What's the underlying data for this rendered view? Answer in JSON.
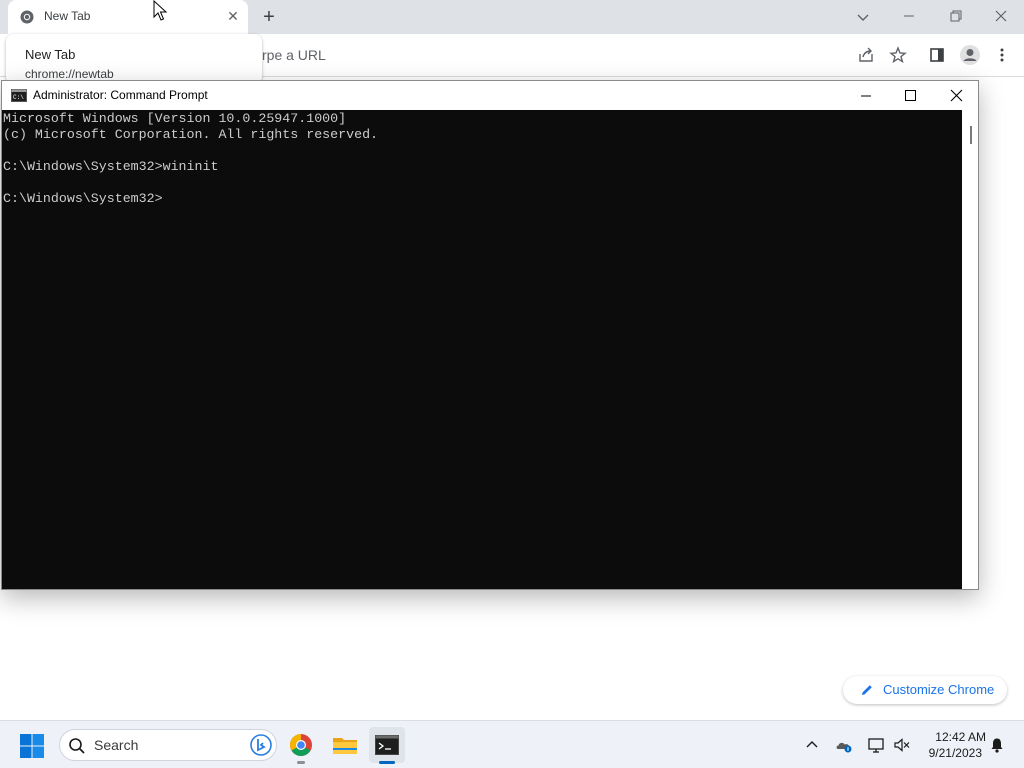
{
  "chrome": {
    "tab": {
      "title": "New Tab",
      "favicon": "chrome-icon",
      "close_icon": "close-icon"
    },
    "new_tab_icon": "plus-icon",
    "hover_card": {
      "title": "New Tab",
      "url": "chrome://newtab"
    },
    "omnibox_placeholder_visible": "rpe a URL",
    "toolbar_icons": [
      "share-icon",
      "star-icon",
      "side-panel-icon",
      "profile-icon",
      "menu-icon"
    ],
    "customize_label": "Customize Chrome"
  },
  "cmd": {
    "title": "Administrator: Command Prompt",
    "lines": [
      "Microsoft Windows [Version 10.0.25947.1000]",
      "(c) Microsoft Corporation. All rights reserved.",
      "",
      "C:\\Windows\\System32>wininit",
      "",
      "C:\\Windows\\System32>"
    ]
  },
  "taskbar": {
    "search_placeholder": "Search",
    "apps": [
      "chrome-app-icon",
      "file-explorer-icon",
      "terminal-icon"
    ],
    "tray_icons": [
      "chevron-up-icon",
      "onedrive-icon",
      "network-icon",
      "volume-muted-icon",
      "notification-bell-icon"
    ],
    "clock": {
      "time": "12:42 AM",
      "date": "9/21/2023"
    }
  },
  "colors": {
    "console_bg": "#0c0c0c",
    "console_text": "#cccccc",
    "accent": "#1a73e8"
  }
}
